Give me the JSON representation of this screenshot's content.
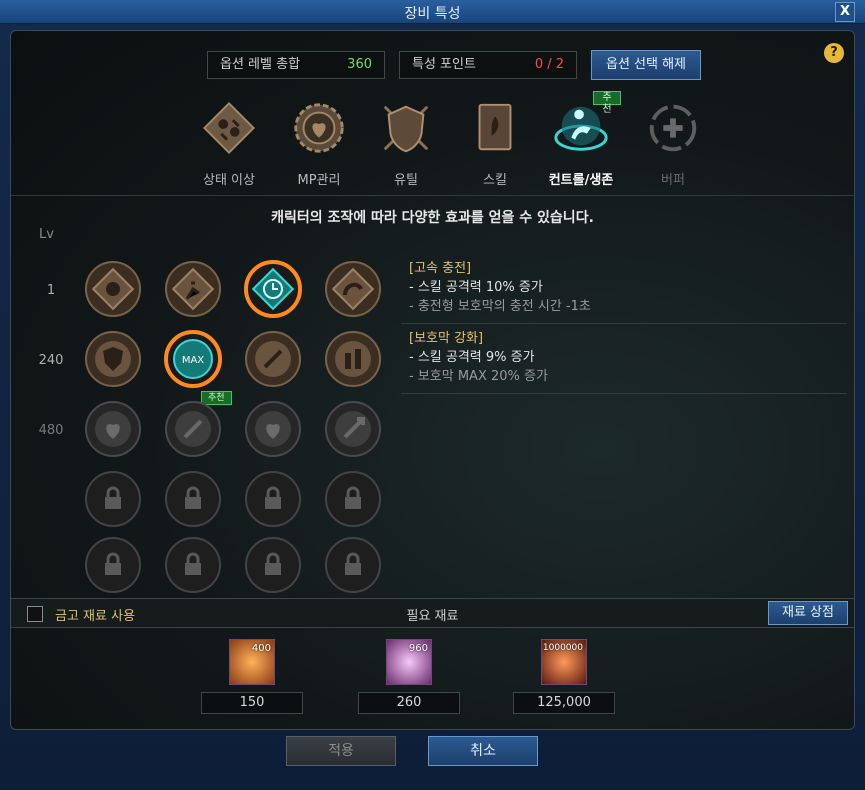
{
  "window": {
    "title": "장비 특성",
    "close_label": "X"
  },
  "stats": {
    "option_level_label": "옵션 레벨 총합",
    "option_level_value": "360",
    "trait_points_label": "특성 포인트",
    "trait_points_value": "0 / 2",
    "reset_button": "옵션 선택 해제"
  },
  "help_label": "?",
  "categories": [
    {
      "label": "상태 이상",
      "icon": "status-effect-icon"
    },
    {
      "label": "MP관리",
      "icon": "mp-gear-icon"
    },
    {
      "label": "유틸",
      "icon": "shield-swords-icon"
    },
    {
      "label": "스킬",
      "icon": "skill-book-icon"
    },
    {
      "label": "컨트롤/생존",
      "icon": "control-survival-icon",
      "active": true,
      "badge": "추천"
    },
    {
      "label": "버퍼",
      "icon": "buffer-icon",
      "disabled": true
    }
  ],
  "description": "캐릭터의 조작에 따라 다양한 효과를 얻을 수 있습니다.",
  "levels_header": "Lv",
  "levels": [
    "1",
    "240",
    "480"
  ],
  "nodes": {
    "max_label": "MAX",
    "recommend_badge": "추천"
  },
  "info": [
    {
      "heading": "[고속 충전]",
      "lines": [
        "- 스킬 공격력 10% 증가",
        "- 충전형 보호막의 충전 시간 -1초"
      ]
    },
    {
      "heading": "[보호막 강화]",
      "lines": [
        "- 스킬 공격력 9% 증가",
        "- 보호막 MAX 20% 증가"
      ]
    }
  ],
  "materials": {
    "use_storage_label": "금고 재료 사용",
    "title": "필요 재료",
    "shop_button": "재료 상점",
    "items": [
      {
        "count": "400",
        "value": "150",
        "color": "#e8702a"
      },
      {
        "count": "960",
        "value": "260",
        "color": "#d27ad8"
      },
      {
        "count": "1000000",
        "value": "125,000",
        "color": "#e0642a"
      }
    ]
  },
  "buttons": {
    "apply": "적용",
    "cancel": "취소"
  },
  "colors": {
    "accent_teal": "#38d6d6",
    "accent_orange": "#ff8a1f",
    "gold_text": "#e2c070"
  }
}
